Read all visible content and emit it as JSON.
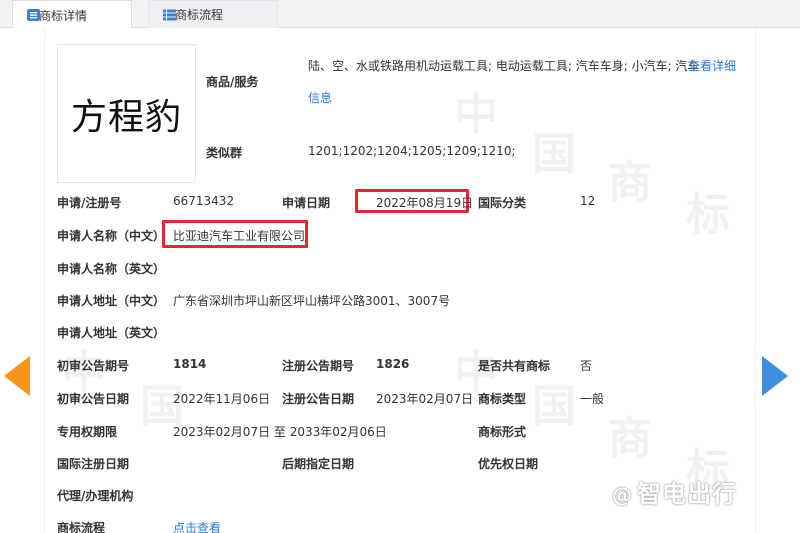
{
  "tabs": [
    {
      "label": "商标详情",
      "active": true
    },
    {
      "label": "商标流程",
      "active": false
    }
  ],
  "trademark": {
    "logo_text": "方程豹",
    "goods_services_label": "商品/服务",
    "goods_services_line1": "陆、空、水或铁路用机动运载工具; 电动运载工具; 汽车车身; 小汽车; 汽车",
    "view_details_label": "查看详细",
    "view_details_label2": "信息",
    "similar_group_label": "类似群",
    "similar_group_value": "1201;1202;1204;1205;1209;1210;"
  },
  "fields": {
    "reg_no_label": "申请/注册号",
    "reg_no_value": "66713432",
    "app_date_label": "申请日期",
    "app_date_value": "2022年08月19日",
    "intl_class_label": "国际分类",
    "intl_class_value": "12",
    "applicant_cn_label": "申请人名称（中文）",
    "applicant_cn_value": "比亚迪汽车工业有限公司",
    "applicant_en_label": "申请人名称（英文）",
    "address_cn_label": "申请人地址（中文）",
    "address_cn_value": "广东省深圳市坪山新区坪山横坪公路3001、3007号",
    "address_en_label": "申请人地址（英文）",
    "prelim_pub_no_label": "初审公告期号",
    "prelim_pub_no_value": "1814",
    "reg_pub_no_label": "注册公告期号",
    "reg_pub_no_value": "1826",
    "shared_label": "是否共有商标",
    "shared_value": "否",
    "prelim_pub_date_label": "初审公告日期",
    "prelim_pub_date_value": "2022年11月06日",
    "reg_pub_date_label": "注册公告日期",
    "reg_pub_date_value": "2023年02月07日",
    "tm_type_label": "商标类型",
    "tm_type_value": "一般",
    "exclusive_period_label": "专用权期限",
    "exclusive_period_value": "2023年02月07日 至 2033年02月06日",
    "tm_form_label": "商标形式",
    "intl_reg_date_label": "国际注册日期",
    "later_designation_label": "后期指定日期",
    "priority_date_label": "优先权日期",
    "agency_label": "代理/办理机构",
    "process_label": "商标流程",
    "process_link": "点击查看"
  },
  "watermark": {
    "chars": [
      "中",
      "国",
      "商",
      "标"
    ]
  },
  "brand": {
    "at": "@",
    "name": "智电出行"
  },
  "colors": {
    "link": "#2a7bd6",
    "highlight": "#e8262f",
    "arrow_left": "#f7941e",
    "arrow_right": "#3d8fdb"
  }
}
